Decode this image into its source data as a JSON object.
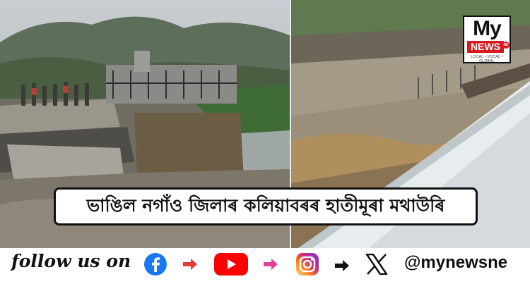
{
  "headline": "ভাঙিল নগাঁও জিলাৰ কলিয়াবৰৰ হাতীমূৰা মথাউৰি",
  "logo": {
    "my": "My",
    "news": "NEWS",
    "ne": "NE",
    "tagline": "LOCAL • VOCAL • GLOBAL"
  },
  "social": {
    "follow_text": "follow us on",
    "handle": "@mynewsne",
    "icons": [
      "facebook-icon",
      "youtube-icon",
      "instagram-icon",
      "x-icon"
    ],
    "arrow_colors": [
      "#e53935",
      "#e0409a",
      "#111111"
    ]
  },
  "colors": {
    "brand_red": "#d71921",
    "facebook": "#1877f2",
    "youtube": "#ff0000",
    "instagram": "#d6249f"
  }
}
